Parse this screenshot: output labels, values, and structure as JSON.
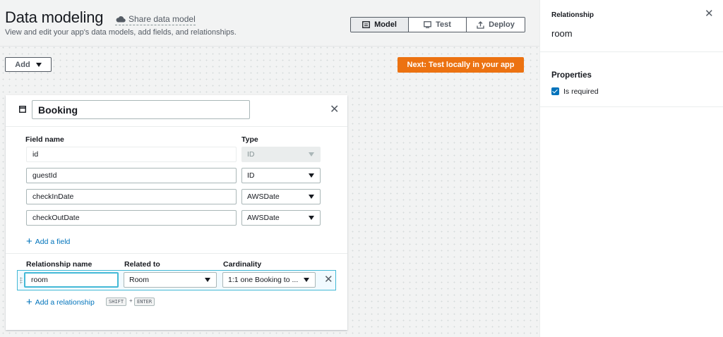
{
  "header": {
    "title": "Data modeling",
    "share_label": "Share data model",
    "subtitle": "View and edit your app's data models, add fields, and relationships.",
    "tabs": [
      {
        "label": "Model",
        "icon": "model-icon",
        "active": true
      },
      {
        "label": "Test",
        "icon": "test-icon",
        "active": false
      },
      {
        "label": "Deploy",
        "icon": "deploy-icon",
        "active": false
      }
    ]
  },
  "toolbar": {
    "add_label": "Add",
    "next_label": "Next: Test locally in your app",
    "next_color": "#ec7211"
  },
  "model": {
    "name": "Booking",
    "field_header": "Field name",
    "type_header": "Type",
    "fields": [
      {
        "name": "id",
        "type": "ID",
        "disabled": true
      },
      {
        "name": "guestId",
        "type": "ID",
        "disabled": false
      },
      {
        "name": "checkInDate",
        "type": "AWSDate",
        "disabled": false
      },
      {
        "name": "checkOutDate",
        "type": "AWSDate",
        "disabled": false
      }
    ],
    "add_field_label": "Add a field",
    "relationship_name_header": "Relationship name",
    "related_to_header": "Related to",
    "cardinality_header": "Cardinality",
    "relationship": {
      "name": "room",
      "related_to": "Room",
      "cardinality": "1:1 one Booking to ..."
    },
    "add_relationship_label": "Add a relationship",
    "shortcut_keys": [
      "SHIFT",
      "ENTER"
    ],
    "shortcut_joiner": "+"
  },
  "panel": {
    "title": "Relationship",
    "name": "room",
    "properties_label": "Properties",
    "is_required_label": "Is required",
    "is_required": true
  }
}
